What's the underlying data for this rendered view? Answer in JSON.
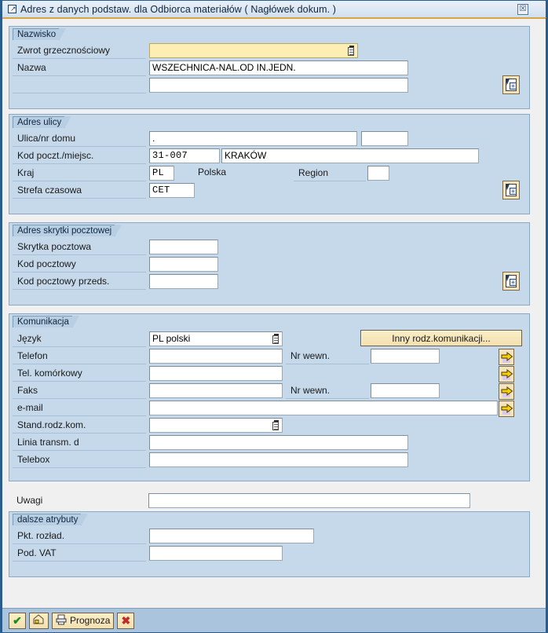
{
  "window": {
    "title": "Adres z danych podstaw. dla Odbiorca materiałów ( Nagłówek dokum. )",
    "title_icon": "window-doc-icon",
    "close_label": "☒"
  },
  "groups": {
    "nazwisko": {
      "legend": "Nazwisko",
      "rows": [
        {
          "label": "Zwrot grzecznościowy",
          "value": "",
          "required": true,
          "matchcode": true
        },
        {
          "label": "Nazwa",
          "value": "WSZECHNICA-NAL.OD IN.JEDN.",
          "required": false,
          "matchcode": false
        },
        {
          "label": "",
          "value": "",
          "required": false,
          "matchcode": false
        }
      ],
      "copy_button": "copy-address-icon"
    },
    "adres_ulicy": {
      "legend": "Adres ulicy",
      "rows": [
        {
          "label": "Ulica/nr domu",
          "value": ".",
          "value2": ""
        },
        {
          "label": "Kod poczt./miejsc.",
          "value": "31-007",
          "value2": "KRAKÓW"
        },
        {
          "label": "Kraj",
          "value": "PL",
          "country_text": "Polska",
          "region_label": "Region",
          "region_value": ""
        },
        {
          "label": "Strefa czasowa",
          "value": "CET"
        }
      ],
      "copy_button": "copy-address-icon"
    },
    "adres_skrytki": {
      "legend": "Adres skrytki pocztowej",
      "rows": [
        {
          "label": "Skrytka pocztowa",
          "value": ""
        },
        {
          "label": "Kod pocztowy",
          "value": ""
        },
        {
          "label": "Kod pocztowy przeds.",
          "value": ""
        }
      ],
      "copy_button": "copy-address-icon"
    },
    "komunikacja": {
      "legend": "Komunikacja",
      "other_comm_button": "Inny rodz.komunikacji...",
      "rows": [
        {
          "label": "Język",
          "value": "PL polski",
          "matchcode": true
        },
        {
          "label": "Telefon",
          "value": "",
          "ext_label": "Nr wewn.",
          "ext_value": "",
          "arrow": true
        },
        {
          "label": "Tel. komórkowy",
          "value": "",
          "arrow": true
        },
        {
          "label": "Faks",
          "value": "",
          "ext_label": "Nr wewn.",
          "ext_value": "",
          "arrow": true
        },
        {
          "label": "e-mail",
          "value": "",
          "wide": true,
          "arrow": true
        },
        {
          "label": "Stand.rodz.kom.",
          "value": "",
          "matchcode": true
        },
        {
          "label": "Linia transm. d",
          "value": ""
        },
        {
          "label": "Telebox",
          "value": ""
        }
      ]
    },
    "uwagi": {
      "label": "Uwagi",
      "value": ""
    },
    "dalsze_atrybuty": {
      "legend": "dalsze atrybuty",
      "rows": [
        {
          "label": "Pkt. rozład.",
          "value": ""
        },
        {
          "label": "Pod. VAT",
          "value": ""
        }
      ]
    }
  },
  "toolbar": {
    "confirm_label": "✔",
    "confirm_icon": "green-check-icon",
    "lock_icon": "lock-house-icon",
    "print_label": "Prognoza",
    "print_icon": "printer-icon",
    "cancel_label": "✖",
    "cancel_icon": "red-x-icon"
  },
  "colors": {
    "panel_bg": "#c6d9ea",
    "dialog_bg": "#f0f0f0",
    "titlebar_accent": "#d9a441",
    "required_field": "#fdeeb3",
    "button_face": "#f2e0b0",
    "border_blue": "#2a5d8f"
  }
}
